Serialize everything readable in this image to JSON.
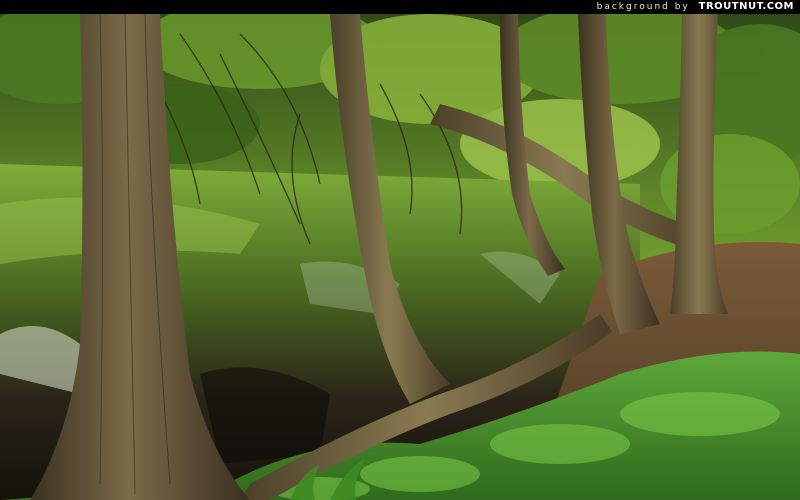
{
  "header": {
    "credit_prefix": "background by",
    "credit_brand": "TROUTNUT.COM"
  },
  "scene": {
    "subject": "forest-stream-with-leaning-tree-trunks",
    "colors": {
      "canopy": "#5f8a2a",
      "water_dark": "#1f1a14",
      "reflection_green": "#7fae3a",
      "bark": "#6b5a3a",
      "ground_moss": "#4f8f2a",
      "bar": "#000000"
    }
  }
}
